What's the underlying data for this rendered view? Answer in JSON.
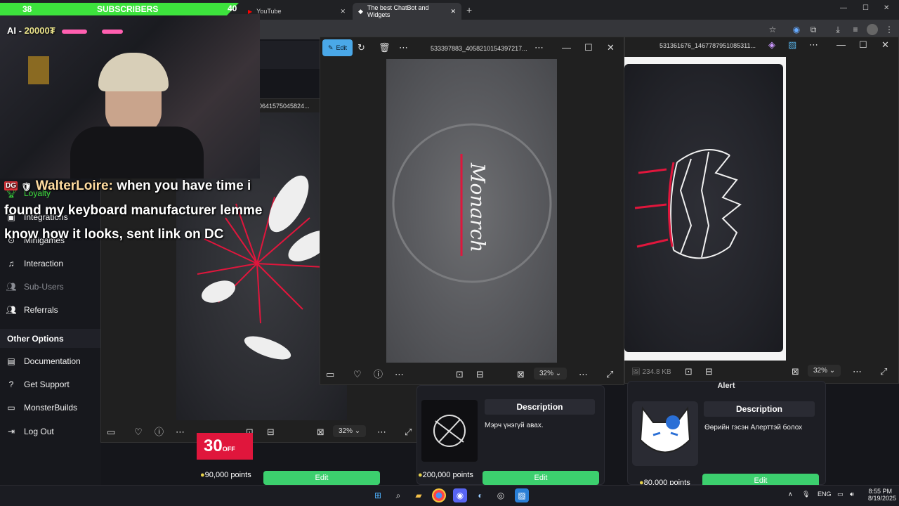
{
  "browser": {
    "tabs": [
      {
        "label": "YouTube"
      },
      {
        "label": "The best ChatBot and Widgets"
      }
    ],
    "new_tab": "+",
    "window_controls": {
      "minimize": "—",
      "maximize": "☐",
      "close": "✕"
    }
  },
  "overlay": {
    "sub_goal": {
      "current": "38",
      "label": "SUBSCRIBERS",
      "target": "40"
    },
    "ai_label": "AI",
    "ai_points": "20000₮",
    "chat": {
      "badges": "DG",
      "username": "WalterLoire:",
      "message": "when you have time i found my keyboard manufacturer lemme know how it looks, sent link on DC"
    }
  },
  "sidebar": {
    "items": [
      {
        "label": "Loyalty",
        "icon": "trophy-icon"
      },
      {
        "label": "Integrations",
        "icon": "integration-icon"
      },
      {
        "label": "Minigames",
        "icon": "gamepad-icon"
      },
      {
        "label": "Interaction",
        "icon": "music-icon"
      },
      {
        "label": "Sub-Users",
        "icon": "users-icon"
      },
      {
        "label": "Referrals",
        "icon": "referral-icon"
      }
    ],
    "other_heading": "Other Options",
    "other_items": [
      {
        "label": "Documentation",
        "icon": "document-icon"
      },
      {
        "label": "Get Support",
        "icon": "help-icon"
      },
      {
        "label": "MonsterBuilds",
        "icon": "laptop-icon"
      },
      {
        "label": "Log Out",
        "icon": "logout-icon"
      }
    ]
  },
  "viewer_back": {
    "filename": "0641575045824...",
    "zoom": "32%"
  },
  "viewer_main": {
    "edit_label": "Edit",
    "filename": "533397883_4058210154397217...",
    "zoom": "32%",
    "shirt_text": "Monarch"
  },
  "viewer_right": {
    "filename": "531361676_1467787951085311...",
    "file_size": "234.8 KB",
    "zoom": "32%"
  },
  "cards": [
    {
      "title": "Description",
      "desc": "Мэрч үнэгүй авах.",
      "points": "200,000 points",
      "edit": "Edit"
    },
    {
      "header": "Alert",
      "title": "Description",
      "desc": "Өөрийн гэсэн Алерттэй болох",
      "points": "80,000 points",
      "edit": "Edit"
    }
  ],
  "left_card": {
    "points": "90,000 points",
    "edit": "Edit",
    "badge": "30",
    "badge_suffix": "OFF"
  },
  "taskbar": {
    "lang": "ENG",
    "time": "8:55 PM",
    "date": "8/19/2025"
  },
  "colors": {
    "accent_green": "#3de33d",
    "edit_green": "#3ccf6e",
    "shirt_red": "#e0163c",
    "viewer_bg": "#202020"
  }
}
